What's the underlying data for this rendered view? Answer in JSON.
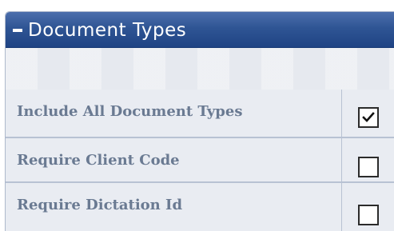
{
  "section": {
    "title": "Document Types",
    "collapse_icon": "minus-icon"
  },
  "options": [
    {
      "label": "Include All Document Types",
      "checked": true
    },
    {
      "label": "Require Client Code",
      "checked": false
    },
    {
      "label": "Require Dictation Id",
      "checked": false
    }
  ],
  "colors": {
    "header_bg": "#2f5594",
    "header_text": "#ffffff",
    "label_text": "#6a7a92",
    "panel_bg": "#e9ecf2"
  }
}
